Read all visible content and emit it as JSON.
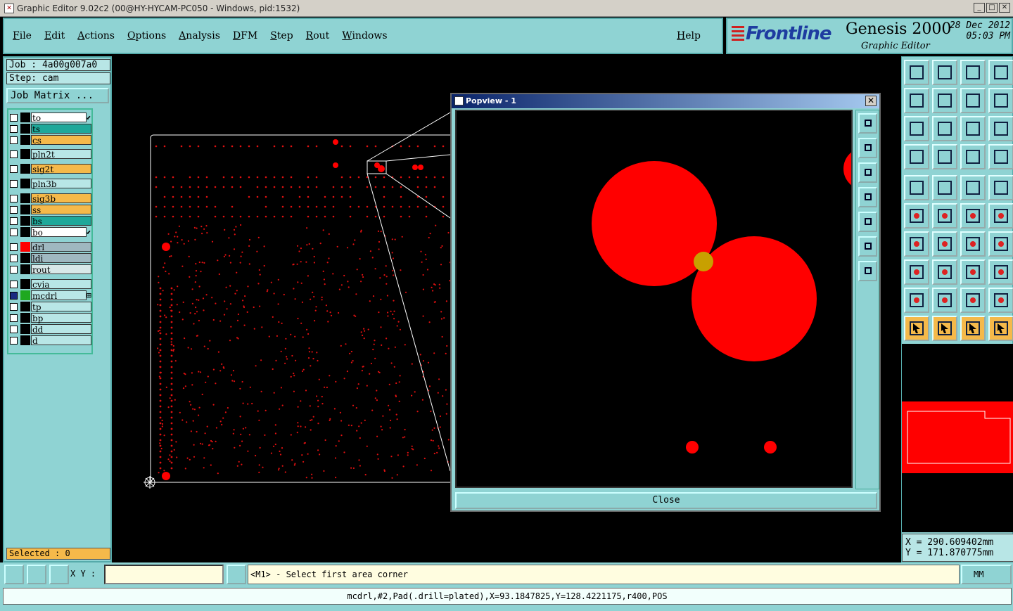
{
  "window": {
    "title": "Graphic Editor 9.02c2 (00@HY-HYCAM-PC050 - Windows, pid:1532)",
    "min": "_",
    "max": "□",
    "close": "✕"
  },
  "menu": {
    "items": [
      "File",
      "Edit",
      "Actions",
      "Options",
      "Analysis",
      "DFM",
      "Step",
      "Rout",
      "Windows"
    ],
    "help": "Help"
  },
  "brand": {
    "logo": "Frontline",
    "product": "Genesis 2000",
    "subtitle": "Graphic Editor",
    "date": "28 Dec 2012",
    "time": "05:03 PM"
  },
  "job": {
    "job": "Job : 4a00g007a0",
    "step": "Step: cam",
    "matrix": "Job Matrix ..."
  },
  "layers": [
    {
      "name": "to",
      "color": "#ffffff",
      "tag": "⬋"
    },
    {
      "name": "ts",
      "color": "#1fa89a"
    },
    {
      "name": "cs",
      "color": "#f5b94a"
    },
    {
      "name": "pln2t",
      "color": "#b8e6e6"
    },
    {
      "name": "sig2t",
      "color": "#f5b94a"
    },
    {
      "name": "pln3b",
      "color": "#b8e6e6"
    },
    {
      "name": "sig3b",
      "color": "#f5b94a"
    },
    {
      "name": "ss",
      "color": "#f5b94a"
    },
    {
      "name": "bs",
      "color": "#1fa89a"
    },
    {
      "name": "bo",
      "color": "#ffffff",
      "tag": "⬋"
    },
    {
      "name": "drl",
      "color": "#9fb8c0",
      "swatch": "#ff0000"
    },
    {
      "name": "ldi",
      "color": "#9fb8c0"
    },
    {
      "name": "rout",
      "color": "#d8e8e8"
    },
    {
      "name": "cvia",
      "color": "#b8e6e6"
    },
    {
      "name": "mcdrl",
      "color": "#b8e6e6",
      "swatch": "#1fa820",
      "checked": true,
      "tag": "⊞"
    },
    {
      "name": "tp",
      "color": "#b8e6e6"
    },
    {
      "name": "bp",
      "color": "#b8e6e6"
    },
    {
      "name": "dd",
      "color": "#b8e6e6"
    },
    {
      "name": "d",
      "color": "#b8e6e6"
    }
  ],
  "selected": "Selected : 0",
  "popup": {
    "title": "Popview - 1",
    "close_label": "Close"
  },
  "coords": {
    "x": "X = 290.609402mm",
    "y": "Y = 171.870775mm"
  },
  "bottom": {
    "xy_label": "X Y :",
    "xy_value": "",
    "hint": "<M1> - Select first area corner",
    "units": "MM",
    "status": "mcdrl,#2,Pad(.drill=plated),X=93.1847825,Y=128.4221175,r400,POS"
  },
  "colors": {
    "panel": "#8fd3d3",
    "pad": "#ff0000",
    "highlight": "#c8a000"
  }
}
